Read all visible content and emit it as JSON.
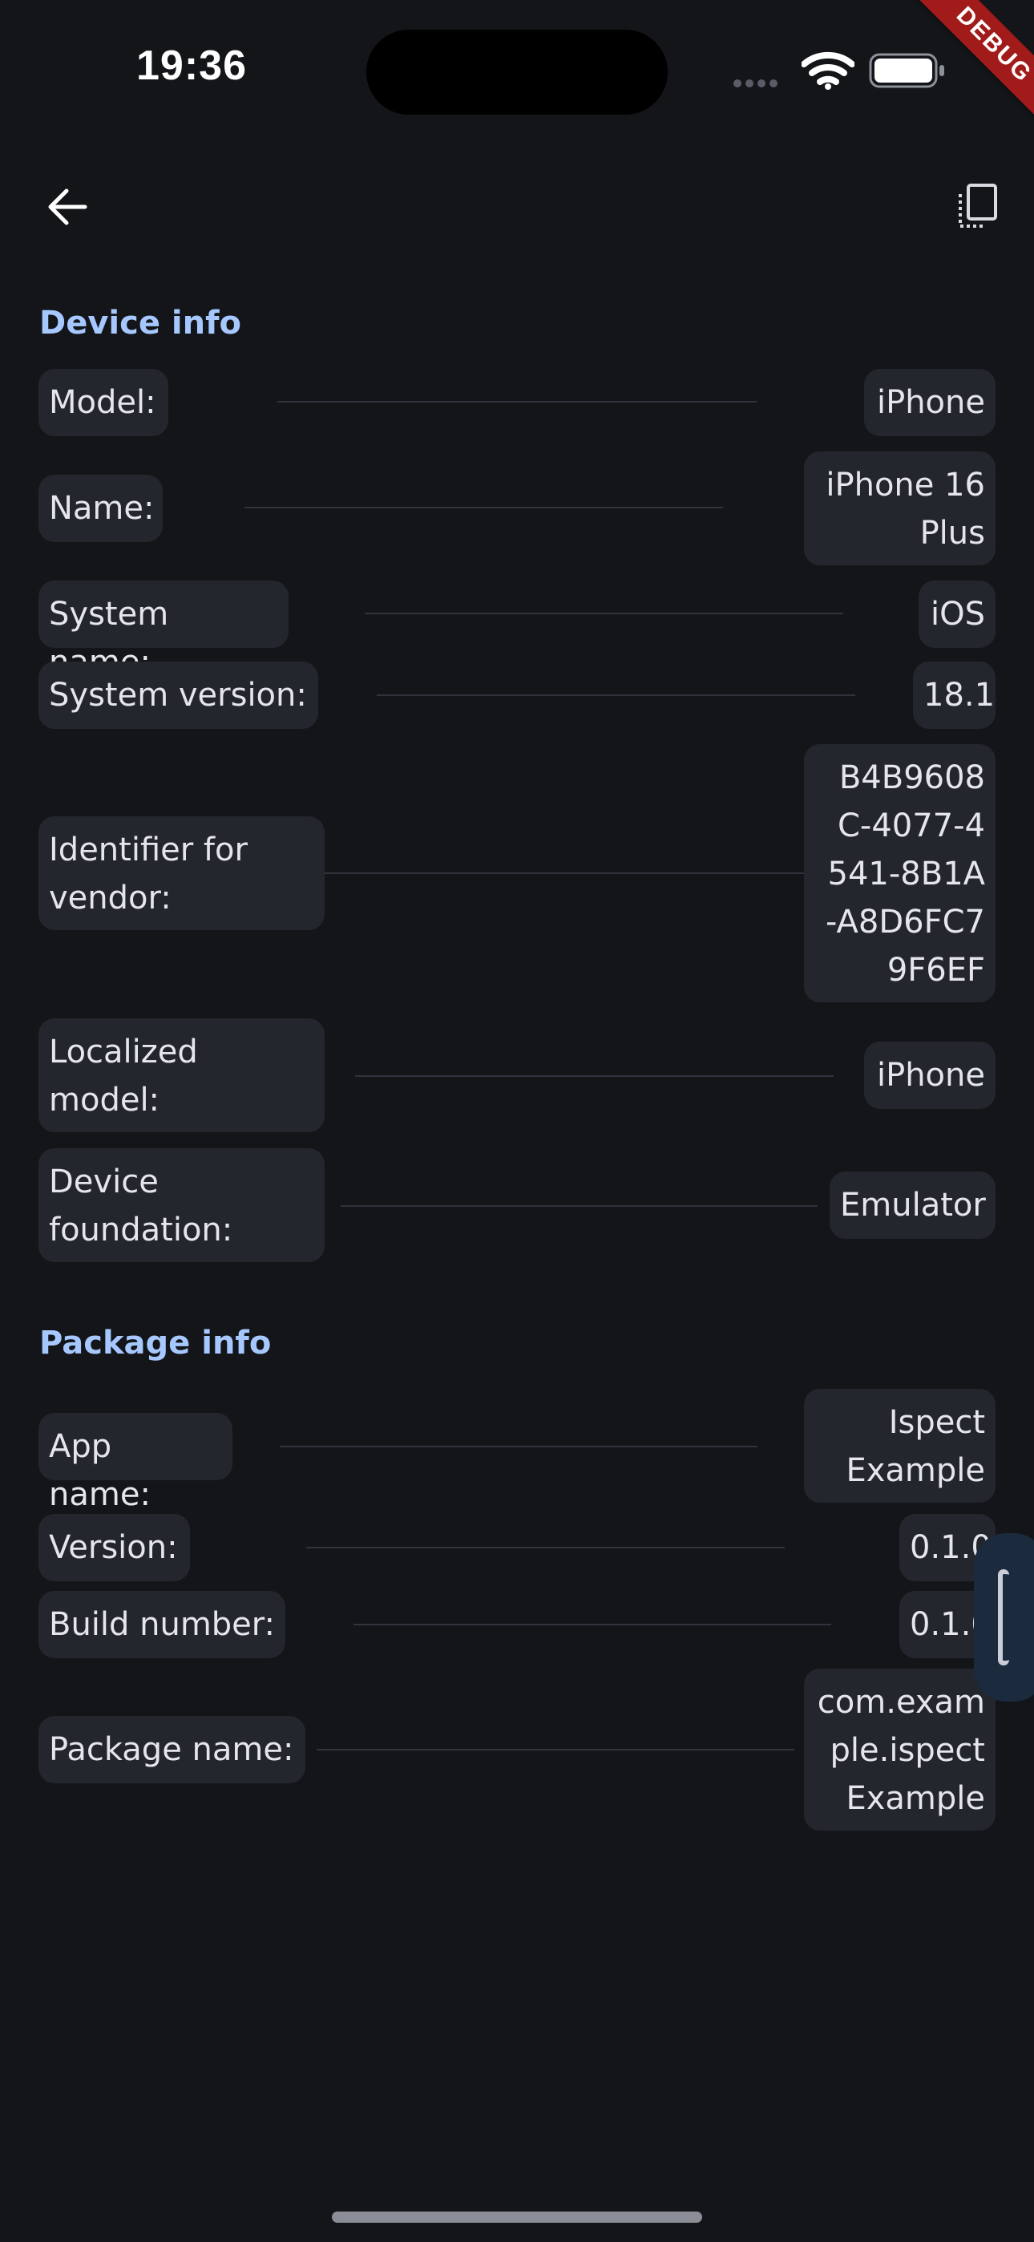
{
  "status_bar": {
    "time": "19:36",
    "debug_banner": "DEBUG"
  },
  "toolbar": {
    "back_icon": "arrow-left-icon",
    "copy_icon": "copy-clipboard-icon"
  },
  "device_info": {
    "title": "Device info",
    "rows": [
      {
        "label": "Model:",
        "value": "iPhone"
      },
      {
        "label": "Name:",
        "value": "iPhone 16\nPlus"
      },
      {
        "label": "System name:",
        "value": "iOS"
      },
      {
        "label": "System version:",
        "value": "18.1"
      },
      {
        "label": "Identifier for\nvendor:",
        "value": "B4B9608\nC-4077-4\n541-8B1A\n-A8D6FC7\n9F6EF"
      },
      {
        "label": "Localized\nmodel:",
        "value": "iPhone"
      },
      {
        "label": "Device\nfoundation:",
        "value": "Emulator"
      }
    ]
  },
  "package_info": {
    "title": "Package info",
    "rows": [
      {
        "label": "App name:",
        "value": "Ispect\nExample"
      },
      {
        "label": "Version:",
        "value": "0.1.0"
      },
      {
        "label": "Build number:",
        "value": "0.1.0"
      },
      {
        "label": "Package name:",
        "value": "com.exam\nple.ispect\nExample"
      }
    ]
  },
  "colors": {
    "background": "#131519",
    "chip": "#23262d",
    "section_title": "#a6c8ff",
    "debug_banner": "#a11b1b"
  }
}
